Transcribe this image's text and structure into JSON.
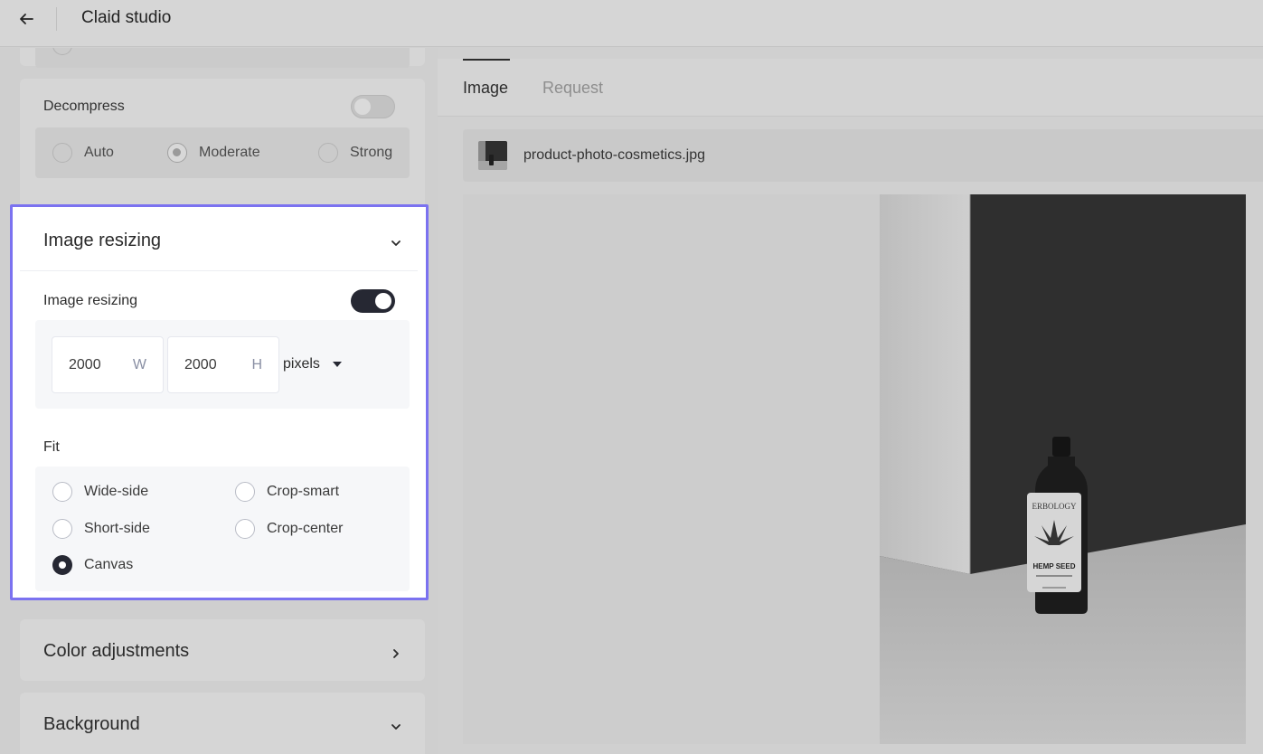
{
  "header": {
    "title": "Claid studio",
    "back_icon": "arrow-left-icon"
  },
  "decompress": {
    "label": "Decompress",
    "enabled": false,
    "options": [
      {
        "label": "Auto",
        "selected": false
      },
      {
        "label": "Moderate",
        "selected": true
      },
      {
        "label": "Strong",
        "selected": false
      }
    ]
  },
  "image_resizing": {
    "section_title": "Image resizing",
    "toggle_label": "Image resizing",
    "enabled": true,
    "width": {
      "value": "2000",
      "unit": "W"
    },
    "height": {
      "value": "2000",
      "unit": "H"
    },
    "units": "pixels",
    "fit_label": "Fit",
    "fit_options": [
      {
        "label": "Wide-side",
        "selected": false
      },
      {
        "label": "Crop-smart",
        "selected": false
      },
      {
        "label": "Short-side",
        "selected": false
      },
      {
        "label": "Crop-center",
        "selected": false
      },
      {
        "label": "Canvas",
        "selected": true
      }
    ]
  },
  "sections": {
    "color_adjustments": "Color adjustments",
    "background": "Background"
  },
  "preview": {
    "tabs": [
      {
        "label": "Image",
        "active": true
      },
      {
        "label": "Request",
        "active": false
      }
    ],
    "file_name": "product-photo-cosmetics.jpg",
    "bottle_label": {
      "brand": "ERBOLOGY",
      "product": "HEMP SEED"
    }
  },
  "colors": {
    "highlight": "#7b72f0",
    "toggle_on": "#262833"
  }
}
